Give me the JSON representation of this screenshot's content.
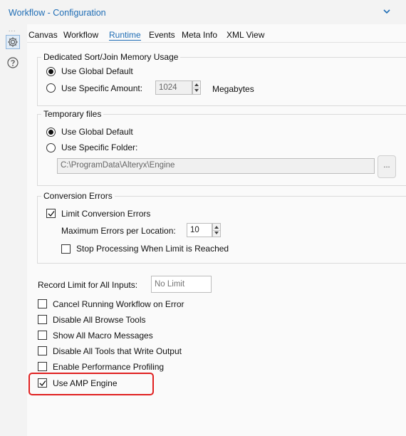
{
  "header": {
    "title": "Workflow - Configuration",
    "collapse_icon": "chevron-down-icon"
  },
  "sidebar": {
    "more_icon": "ellipsis-icon",
    "dots": "...",
    "config_icon": "gear-icon",
    "help_icon": "help-icon"
  },
  "tabs": [
    {
      "label": "Canvas"
    },
    {
      "label": "Workflow"
    },
    {
      "label": "Runtime",
      "active": true
    },
    {
      "label": "Events"
    },
    {
      "label": "Meta Info"
    },
    {
      "label": "XML View"
    }
  ],
  "sort_join": {
    "legend": "Dedicated Sort/Join Memory Usage",
    "global_label": "Use Global Default",
    "specific_label": "Use Specific Amount:",
    "amount_value": "1024",
    "unit_label": "Megabytes",
    "selected": "global"
  },
  "temp_files": {
    "legend": "Temporary files",
    "global_label": "Use Global Default",
    "specific_label": "Use Specific Folder:",
    "folder_value": "C:\\ProgramData\\Alteryx\\Engine",
    "browse_label": "...",
    "selected": "global"
  },
  "conversion": {
    "legend": "Conversion Errors",
    "limit_label": "Limit Conversion Errors",
    "limit_checked": true,
    "max_label": "Maximum Errors per Location:",
    "max_value": "10",
    "stop_label": "Stop Processing When Limit is Reached",
    "stop_checked": false
  },
  "record_limit": {
    "label": "Record Limit for All Inputs:",
    "placeholder": "No Limit"
  },
  "options": [
    {
      "label": "Cancel Running Workflow on Error",
      "checked": false
    },
    {
      "label": "Disable All Browse Tools",
      "checked": false
    },
    {
      "label": "Show All Macro Messages",
      "checked": false
    },
    {
      "label": "Disable All Tools that Write Output",
      "checked": false
    },
    {
      "label": "Enable Performance Profiling",
      "checked": false
    },
    {
      "label": "Use AMP Engine",
      "checked": true
    }
  ],
  "colors": {
    "accent": "#1f6db5",
    "highlight": "#e02020"
  }
}
